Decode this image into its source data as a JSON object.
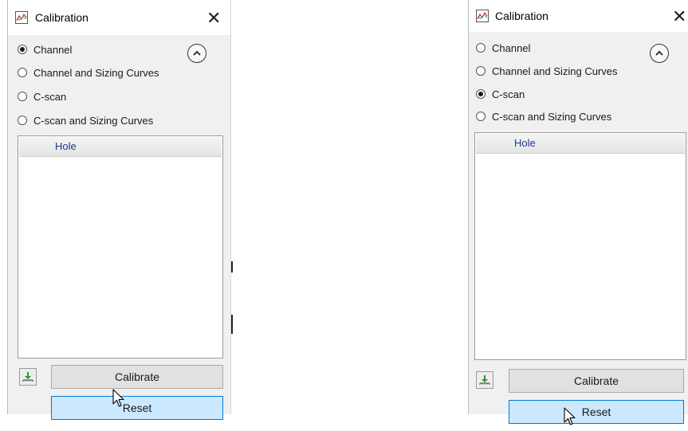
{
  "left_panel": {
    "title": "Calibration",
    "close_glyph": "✕",
    "options": [
      {
        "label": "Channel",
        "checked": true
      },
      {
        "label": "Channel and Sizing Curves",
        "checked": false
      },
      {
        "label": "C-scan",
        "checked": false
      },
      {
        "label": "C-scan and Sizing Curves",
        "checked": false
      }
    ],
    "list_header": "Hole",
    "calibrate_label": "Calibrate",
    "reset_label": "Reset",
    "reset_hovered": true
  },
  "right_panel": {
    "title": "Calibration",
    "close_glyph": "✕",
    "options": [
      {
        "label": "Channel",
        "checked": false
      },
      {
        "label": "Channel and Sizing Curves",
        "checked": false
      },
      {
        "label": "C-scan",
        "checked": true
      },
      {
        "label": "C-scan and Sizing Curves",
        "checked": false
      }
    ],
    "list_header": "Hole",
    "calibrate_label": "Calibrate",
    "reset_label": "Reset",
    "reset_hovered": true
  },
  "icons": {
    "app_icon": "chart-line-icon",
    "collapse": "chevron-up-icon",
    "download": "download-icon",
    "cursor": "mouse-pointer-icon"
  },
  "colors": {
    "panel_bg": "#f0f0f0",
    "list_header_text": "#1f3c8c",
    "reset_bg": "#cce8ff",
    "reset_border": "#0078d7"
  }
}
